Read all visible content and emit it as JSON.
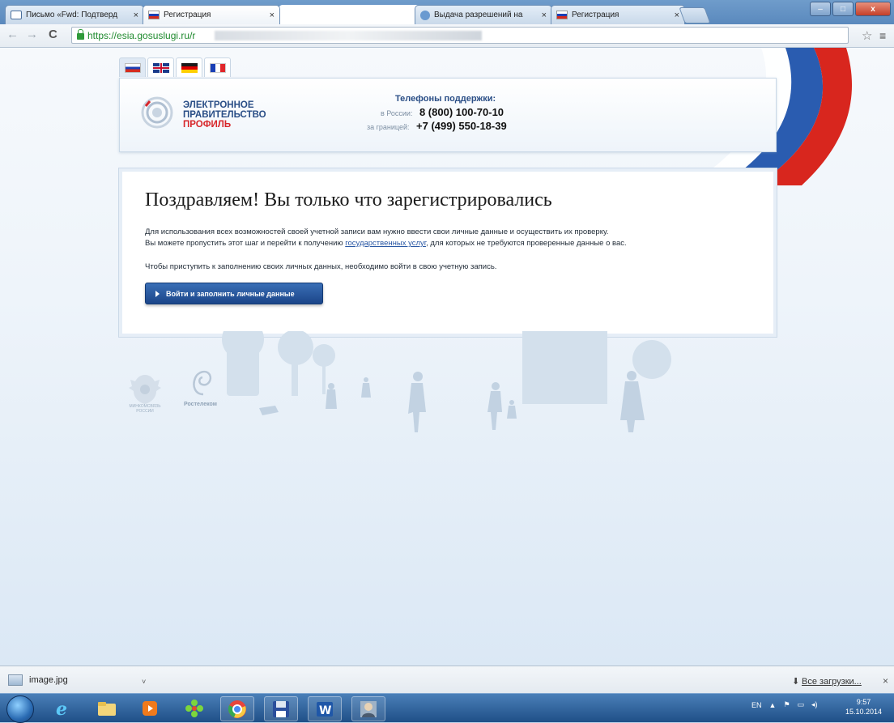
{
  "browser": {
    "tabs": [
      {
        "label": "Письмо «Fwd: Подтверд",
        "icon": "mail-icon"
      },
      {
        "label": "Регистрация",
        "icon": "ru-flag-icon",
        "active": true
      },
      {
        "label": "",
        "icon": "blank"
      },
      {
        "label": "Выдача разрешений на",
        "icon": "globe-icon"
      },
      {
        "label": "Регистрация",
        "icon": "ru-flag-icon"
      }
    ],
    "tab_close": "×",
    "url": "https://esia.gosuslugi.ru/r",
    "nav_back": "←",
    "nav_forward": "→",
    "nav_reload": "C",
    "star": "☆",
    "menu": "≡",
    "win_min": "–",
    "win_max": "□",
    "win_close": "x"
  },
  "page": {
    "languages": [
      "ru",
      "en",
      "de",
      "fr"
    ],
    "logo": {
      "line1": "ЭЛЕКТРОННОЕ",
      "line2": "ПРАВИТЕЛЬСТВО",
      "line3": "ПРОФИЛЬ"
    },
    "support": {
      "title": "Телефоны поддержки:",
      "russia_label": "в России:",
      "russia_number": "8 (800) 100-70-10",
      "abroad_label": "за границей:",
      "abroad_number": "+7 (499) 550-18-39"
    },
    "card": {
      "heading": "Поздравляем! Вы только что зарегистрировались",
      "p1": "Для использования всех возможностей своей учетной записи вам нужно ввести свои личные данные и осуществить их проверку.",
      "p2_before": "Вы можете пропустить этот шаг и перейти к получению ",
      "p2_link": "государственных услуг",
      "p2_after": ", для которых не требуются проверенные данные о вас.",
      "p3": "Чтобы приступить к заполнению своих личных данных, необходимо войти в свою учетную запись.",
      "button": "Войти и заполнить личные данные"
    },
    "footer": {
      "ministry": "МИНКОМСВЯЗЬ РОССИИ",
      "rostelecom": "Ростелеком"
    }
  },
  "downloads": {
    "file": "image.jpg",
    "caret": "˅",
    "all": "Все загрузки...",
    "close": "×"
  },
  "taskbar": {
    "lang": "EN",
    "time": "9:57",
    "date": "15.10.2014"
  }
}
